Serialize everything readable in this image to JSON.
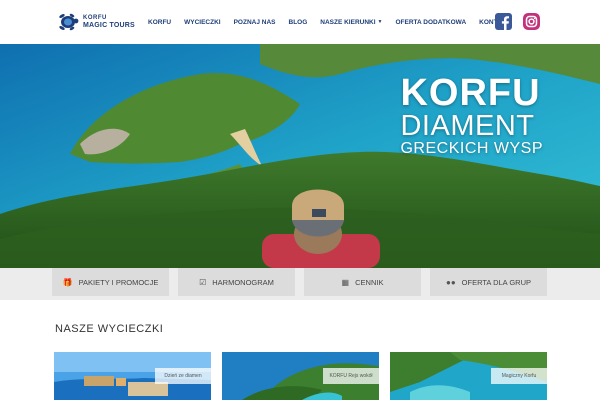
{
  "brand": {
    "line1": "KORFU",
    "line2": "MAGIC TOURS"
  },
  "nav": [
    {
      "label": "KORFU"
    },
    {
      "label": "WYCIECZKI"
    },
    {
      "label": "POZNAJ NAS"
    },
    {
      "label": "BLOG"
    },
    {
      "label": "NASZE KIERUNKI",
      "dropdown": true
    },
    {
      "label": "OFERTA DODATKOWA"
    },
    {
      "label": "KONTAKT"
    }
  ],
  "social": {
    "facebook_icon": "facebook-icon",
    "instagram_icon": "instagram-icon"
  },
  "hero": {
    "title_line1": "KORFU",
    "title_line2": "DIAMENT",
    "title_line3": "GRECKICH WYSP"
  },
  "quick_buttons": [
    {
      "label": "PAKIETY I PROMOCJE",
      "icon": "gift-icon"
    },
    {
      "label": "HARMONOGRAM",
      "icon": "calendar-check-icon"
    },
    {
      "label": "CENNIK",
      "icon": "money-icon"
    },
    {
      "label": "OFERTA DLA GRUP",
      "icon": "users-icon"
    }
  ],
  "section": {
    "title": "NASZE WYCIECZKI"
  },
  "cards": [
    {
      "label": "Dzień ze diamen"
    },
    {
      "label": "KORFU Rejs wokół"
    },
    {
      "label": "Magiczny Korfu"
    }
  ],
  "colors": {
    "nav_text": "#1e3e7a",
    "facebook": "#3b5998",
    "instagram": "#c2327c",
    "button_bg": "#dcdcdc",
    "strip_bg": "#ececec"
  }
}
